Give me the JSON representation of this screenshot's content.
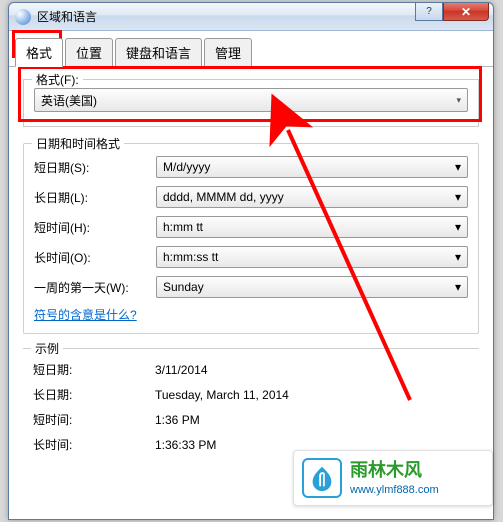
{
  "window": {
    "title": "区域和语言",
    "close_glyph": "✕",
    "help_glyph": "?"
  },
  "tabs": {
    "format": "格式",
    "location": "位置",
    "keyboard": "键盘和语言",
    "admin": "管理"
  },
  "format": {
    "legend": "格式(F):",
    "value": "英语(美国)"
  },
  "datetime_group": {
    "legend": "日期和时间格式",
    "short_date_label": "短日期(S):",
    "short_date_value": "M/d/yyyy",
    "long_date_label": "长日期(L):",
    "long_date_value": "dddd, MMMM dd, yyyy",
    "short_time_label": "短时间(H):",
    "short_time_value": "h:mm tt",
    "long_time_label": "长时间(O):",
    "long_time_value": "h:mm:ss tt",
    "first_day_label": "一周的第一天(W):",
    "first_day_value": "Sunday",
    "link": "符号的含意是什么?"
  },
  "example_group": {
    "legend": "示例",
    "short_date_label": "短日期:",
    "short_date_value": "3/11/2014",
    "long_date_label": "长日期:",
    "long_date_value": "Tuesday, March 11, 2014",
    "short_time_label": "短时间:",
    "short_time_value": "1:36 PM",
    "long_time_label": "长时间:",
    "long_time_value": "1:36:33 PM"
  },
  "watermark": {
    "name": "雨林木风",
    "url": "www.ylmf888.com"
  },
  "arrow_glyph": "▾"
}
